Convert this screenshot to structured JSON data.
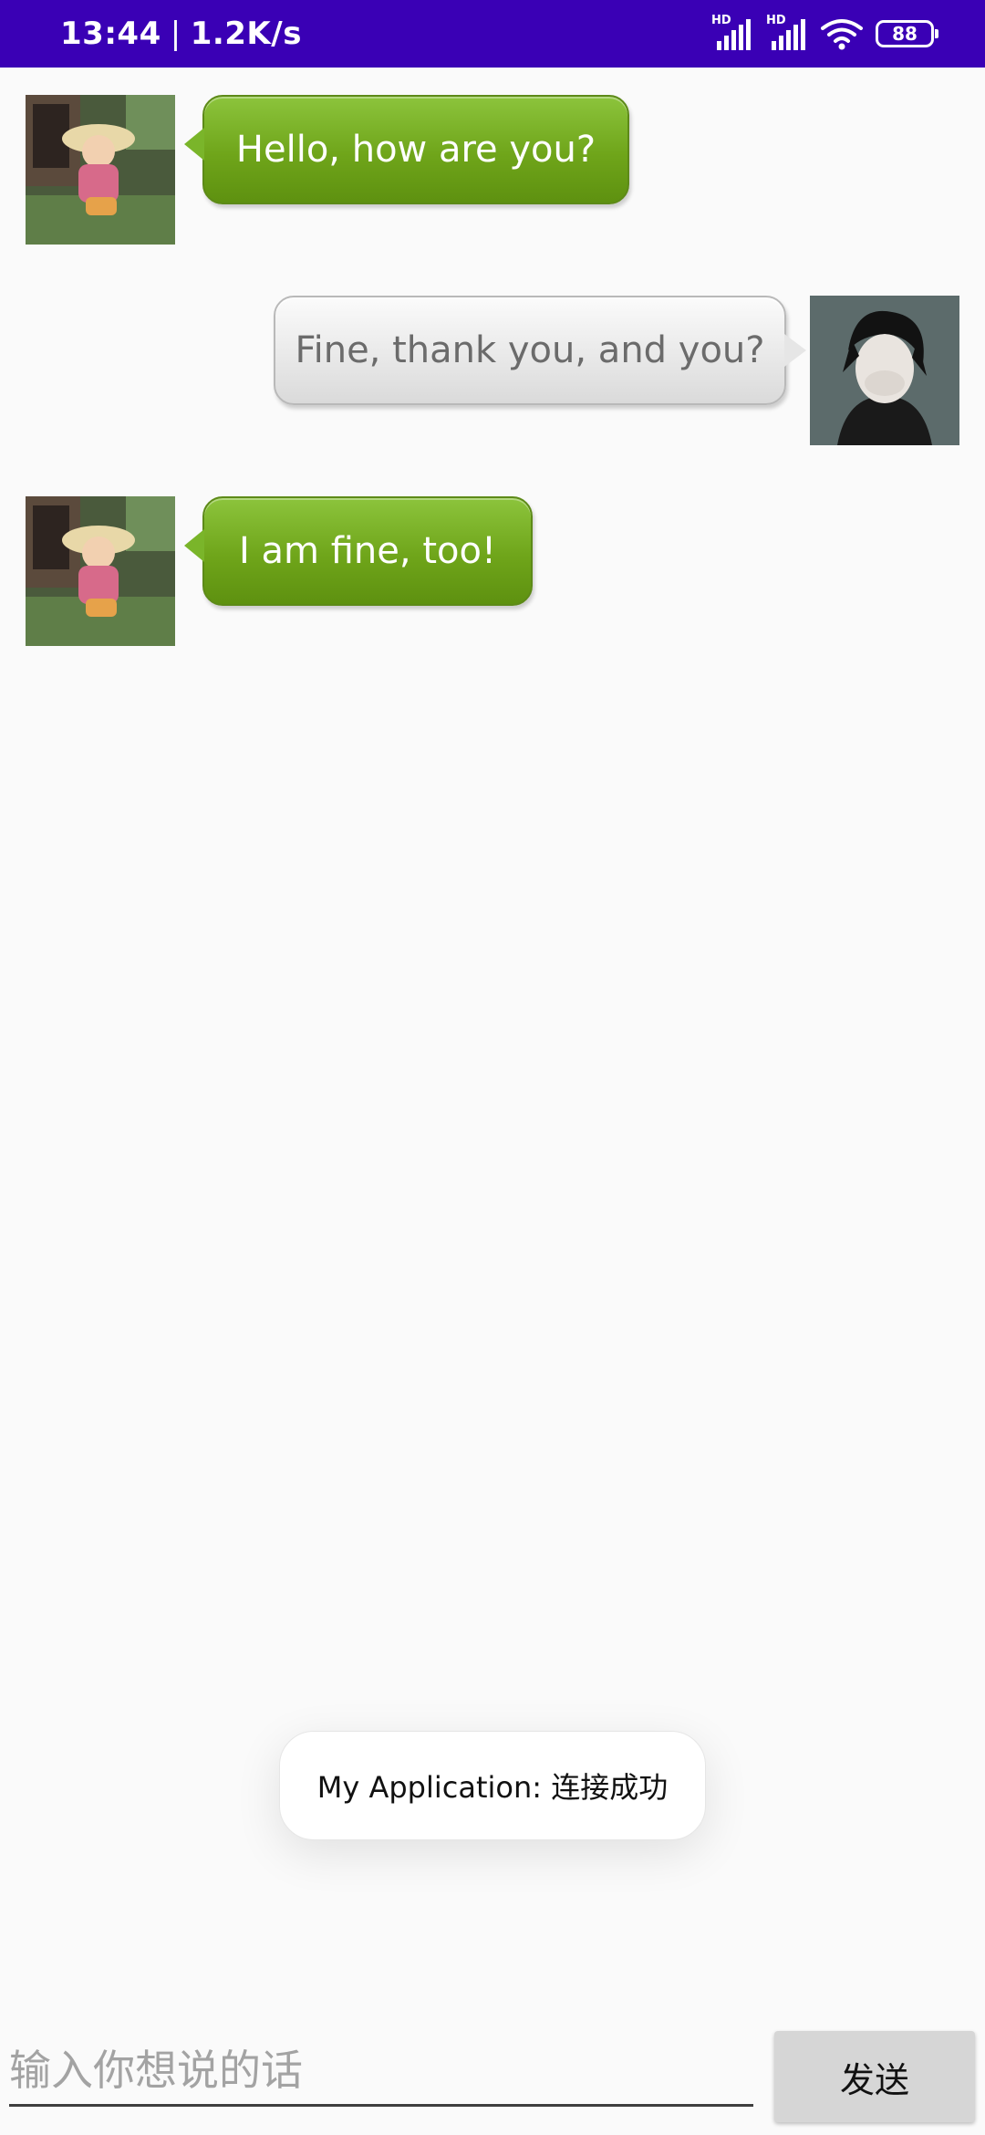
{
  "status_bar": {
    "time": "13:44",
    "separator": "|",
    "net_speed": "1.2K/s",
    "sim1_label": "HD",
    "sim2_label": "HD",
    "battery": "88"
  },
  "messages": [
    {
      "side": "received",
      "text": "Hello, how are you?"
    },
    {
      "side": "sent",
      "text": "Fine, thank you, and you?"
    },
    {
      "side": "received",
      "text": "I am fine, too!"
    }
  ],
  "toast": {
    "text": "My Application: 连接成功"
  },
  "composer": {
    "placeholder": "输入你想说的话",
    "send_label": "发送"
  },
  "colors": {
    "status_bar_bg": "#3a00b5",
    "received_bubble": "#6fa51a",
    "sent_bubble": "#e9e9e9",
    "background": "#fafafa"
  }
}
